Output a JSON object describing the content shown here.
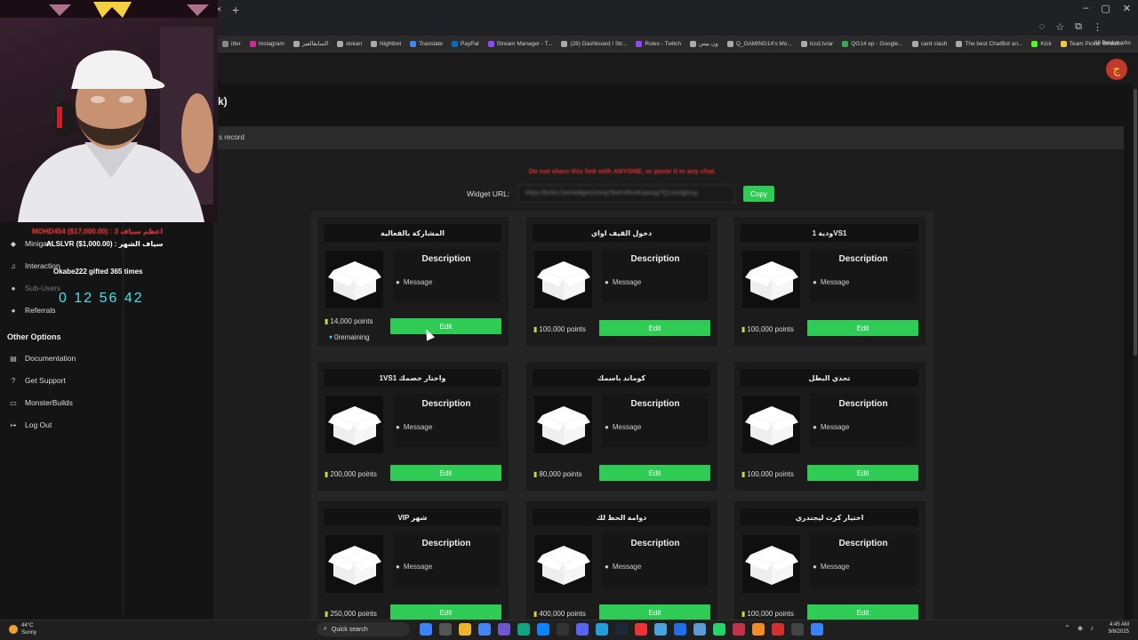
{
  "browser": {
    "close_tab": "×",
    "new_tab": "+",
    "all_bookmarks": "All Bookmarks",
    "bookmarks": [
      {
        "label": "itter",
        "color": "#888888"
      },
      {
        "label": "Instagram",
        "color": "#d6249f"
      },
      {
        "label": "السابقالفيز",
        "color": "#aaaaaa"
      },
      {
        "label": "dokan",
        "color": "#aaaaaa"
      },
      {
        "label": "Nightbot",
        "color": "#aaaaaa"
      },
      {
        "label": "Translate",
        "color": "#4285f4"
      },
      {
        "label": "PayPal",
        "color": "#0070ba"
      },
      {
        "label": "Stream Manager - T...",
        "color": "#9146ff"
      },
      {
        "label": "(28) Dashboard / Str...",
        "color": "#aaaaaa"
      },
      {
        "label": "Roles - Twitch",
        "color": "#9146ff"
      },
      {
        "label": "ون بيس",
        "color": "#aaaaaa"
      },
      {
        "label": "Q_GAMING14's Mo...",
        "color": "#aaaaaa"
      },
      {
        "label": "tccd.tv/ar",
        "color": "#aaaaaa"
      },
      {
        "label": "QG14 ep - Google...",
        "color": "#34a853"
      },
      {
        "label": "card clash",
        "color": "#aaaaaa"
      },
      {
        "label": "The best ChatBot an...",
        "color": "#aaaaaa"
      },
      {
        "label": "Kick",
        "color": "#53fc18"
      },
      {
        "label": "Team Picker Wheel...",
        "color": "#f5c542"
      }
    ]
  },
  "page": {
    "title": "k)",
    "tab_record": "s record",
    "warning": "Do not share this link with ANYONE, or paste it in any chat.",
    "widget_label": "Widget URL:",
    "widget_url": "https://botrix.live/widgets/shop?bid=d9n4Kqaoqg7Q1xIx8glsng",
    "copy_label": "Copy"
  },
  "cards": [
    {
      "title": "المشاركة بالفعالية",
      "desc": "Description",
      "msg": "Message",
      "points": "14,000 points",
      "remaining": "0remaining",
      "edit": "Edit"
    },
    {
      "title": "دخول القيف اواي",
      "desc": "Description",
      "msg": "Message",
      "points": "100,000 points",
      "edit": "Edit"
    },
    {
      "title": "ودية 1VS1",
      "desc": "Description",
      "msg": "Message",
      "points": "100,000 points",
      "edit": "Edit"
    },
    {
      "title": "1VS1 واختار خصمك",
      "desc": "Description",
      "msg": "Message",
      "points": "200,000 points",
      "edit": "Edit"
    },
    {
      "title": "كوماند باسمك",
      "desc": "Description",
      "msg": "Message",
      "points": "80,000 points",
      "edit": "Edit"
    },
    {
      "title": "تحدي البطل",
      "desc": "Description",
      "msg": "Message",
      "points": "100,000 points",
      "edit": "Edit"
    },
    {
      "title": "VIP شهر",
      "desc": "Description",
      "msg": "Message",
      "points": "250,000 points",
      "edit": "Edit"
    },
    {
      "title": "دوامة الحظ لك",
      "desc": "Description",
      "msg": "Message",
      "points": "400,000 points",
      "edit": "Edit"
    },
    {
      "title": "اختيار كرت ليجندري",
      "desc": "Description",
      "msg": "Message",
      "points": "100,000 points",
      "edit": "Edit"
    }
  ],
  "sidebar": {
    "items": [
      {
        "label": "Minigam",
        "icon": "gamepad-icon"
      },
      {
        "label": "Interaction",
        "icon": "music-icon"
      },
      {
        "label": "Sub-Users",
        "icon": "users-icon"
      },
      {
        "label": "Referrals",
        "icon": "referrals-icon"
      }
    ],
    "other_header": "Other Options",
    "other_items": [
      {
        "label": "Documentation",
        "icon": "docs-icon"
      },
      {
        "label": "Get Support",
        "icon": "help-icon"
      },
      {
        "label": "MonsterBuilds",
        "icon": "monitor-icon"
      },
      {
        "label": "Log Out",
        "icon": "logout-icon"
      }
    ]
  },
  "overlay": {
    "line1": "MOHD454 ($17,000.00) : اعظم سياف 3",
    "line2": "ALSLVR ($1,000.00) : سياف الشهر",
    "line3": "Okabe222 gifted 365 times",
    "timer": "0  12  56  42"
  },
  "taskbar": {
    "temp": "44°C",
    "weather": "Sunny",
    "search": "Quick search",
    "time": "4:45 AM",
    "date": "9/8/2025"
  }
}
